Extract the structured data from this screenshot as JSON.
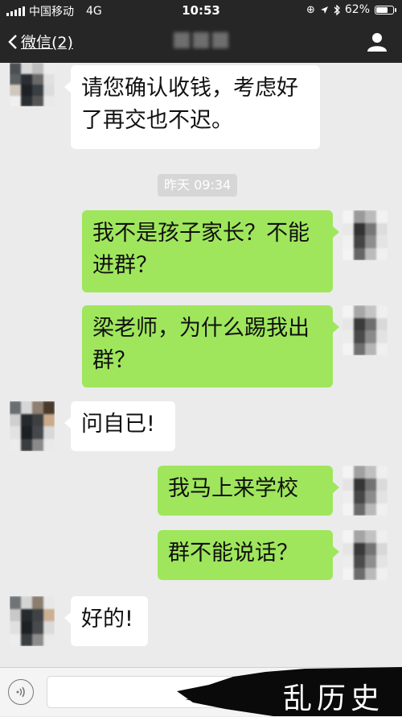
{
  "status_bar": {
    "carrier": "中国移动",
    "network": "4G",
    "time": "10:53",
    "battery": "62%",
    "battery_level": 0.62
  },
  "nav": {
    "back_label": "微信(2)"
  },
  "messages": [
    {
      "side": "left",
      "text": "请您确认收钱，考虑好了再交也不迟。"
    },
    {
      "type": "timestamp",
      "text": "昨天 09:34"
    },
    {
      "side": "right",
      "text": "我不是孩子家长？不能进群？"
    },
    {
      "side": "right",
      "text": "梁老师，为什么踢我出群？"
    },
    {
      "side": "left",
      "text": "问自已!"
    },
    {
      "side": "right",
      "text": "我马上来学校"
    },
    {
      "side": "right",
      "text": "群不能说话？"
    },
    {
      "side": "left",
      "text": "好的!"
    }
  ],
  "watermark": "乱历史",
  "colors": {
    "bar": "#262626",
    "chat_bg": "#ebebeb",
    "bubble_right": "#9fe65c",
    "bubble_left": "#ffffff"
  },
  "icons": [
    "signal-icon",
    "location-icon",
    "bluetooth-icon",
    "battery-icon",
    "chevron-left-icon",
    "contact-icon",
    "voice-icon"
  ]
}
